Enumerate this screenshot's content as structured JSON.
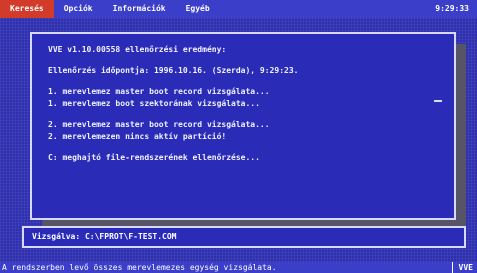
{
  "menu": {
    "items": [
      "Keresés",
      "Opciók",
      "Információk",
      "Egyéb"
    ],
    "active": 0,
    "clock": "9:29:33"
  },
  "results": {
    "title": "VVE v1.10.00558 ellenőrzési eredmény:",
    "timestamp": "Ellenőrzés időpontja: 1996.10.16. (Szerda),  9:29:23.",
    "group1": [
      "1. merevlemez master boot record vizsgálata...",
      "1. merevlemez boot szektorának vizsgálata..."
    ],
    "group2": [
      "2. merevlemez master boot record vizsgálata...",
      "2. merevlemezen nincs aktív partíció!"
    ],
    "group3": [
      "C: meghajtó file-rendszerének ellenőrzése..."
    ]
  },
  "status": {
    "scanning": "Vizsgálva: C:\\FPROT\\F-TEST.COM"
  },
  "bottom": {
    "message": "A rendszerben levő összes merevlemezes egység vizsgálata.",
    "app": "VVE"
  },
  "colors": {
    "background": "#2e30b0",
    "panel": "#2a2cb8",
    "menubar": "#3a3ec8",
    "active_menu": "#d23a2a",
    "border": "#d8d8ff"
  }
}
